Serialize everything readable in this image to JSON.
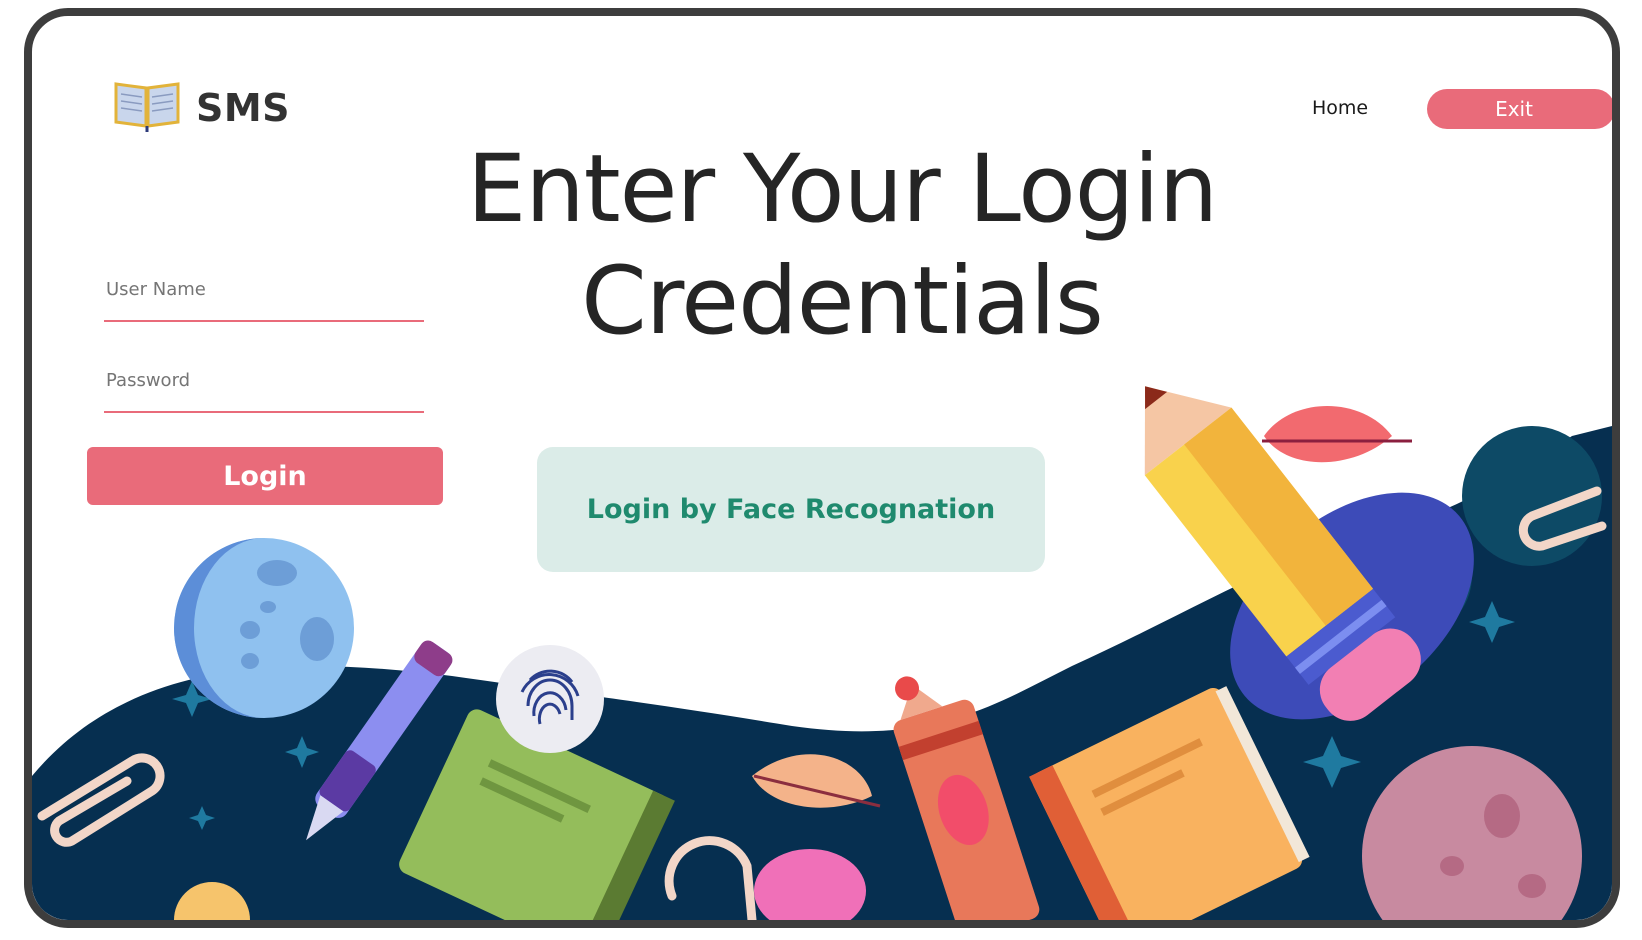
{
  "brand": {
    "name": "SMS",
    "icon": "book-icon"
  },
  "nav": {
    "home_label": "Home",
    "exit_label": "Exit"
  },
  "page": {
    "title_line1": "Enter Your Login",
    "title_line2": "Credentials"
  },
  "form": {
    "username_placeholder": "User Name",
    "password_placeholder": "Password",
    "login_label": "Login"
  },
  "face_login": {
    "label": "Login by Face Recognation",
    "icon": "fingerprint-icon"
  },
  "colors": {
    "accent": "#e96b7a",
    "face_button_bg": "#dbece8",
    "face_button_text": "#1f8a6e",
    "wave": "#062f50"
  }
}
